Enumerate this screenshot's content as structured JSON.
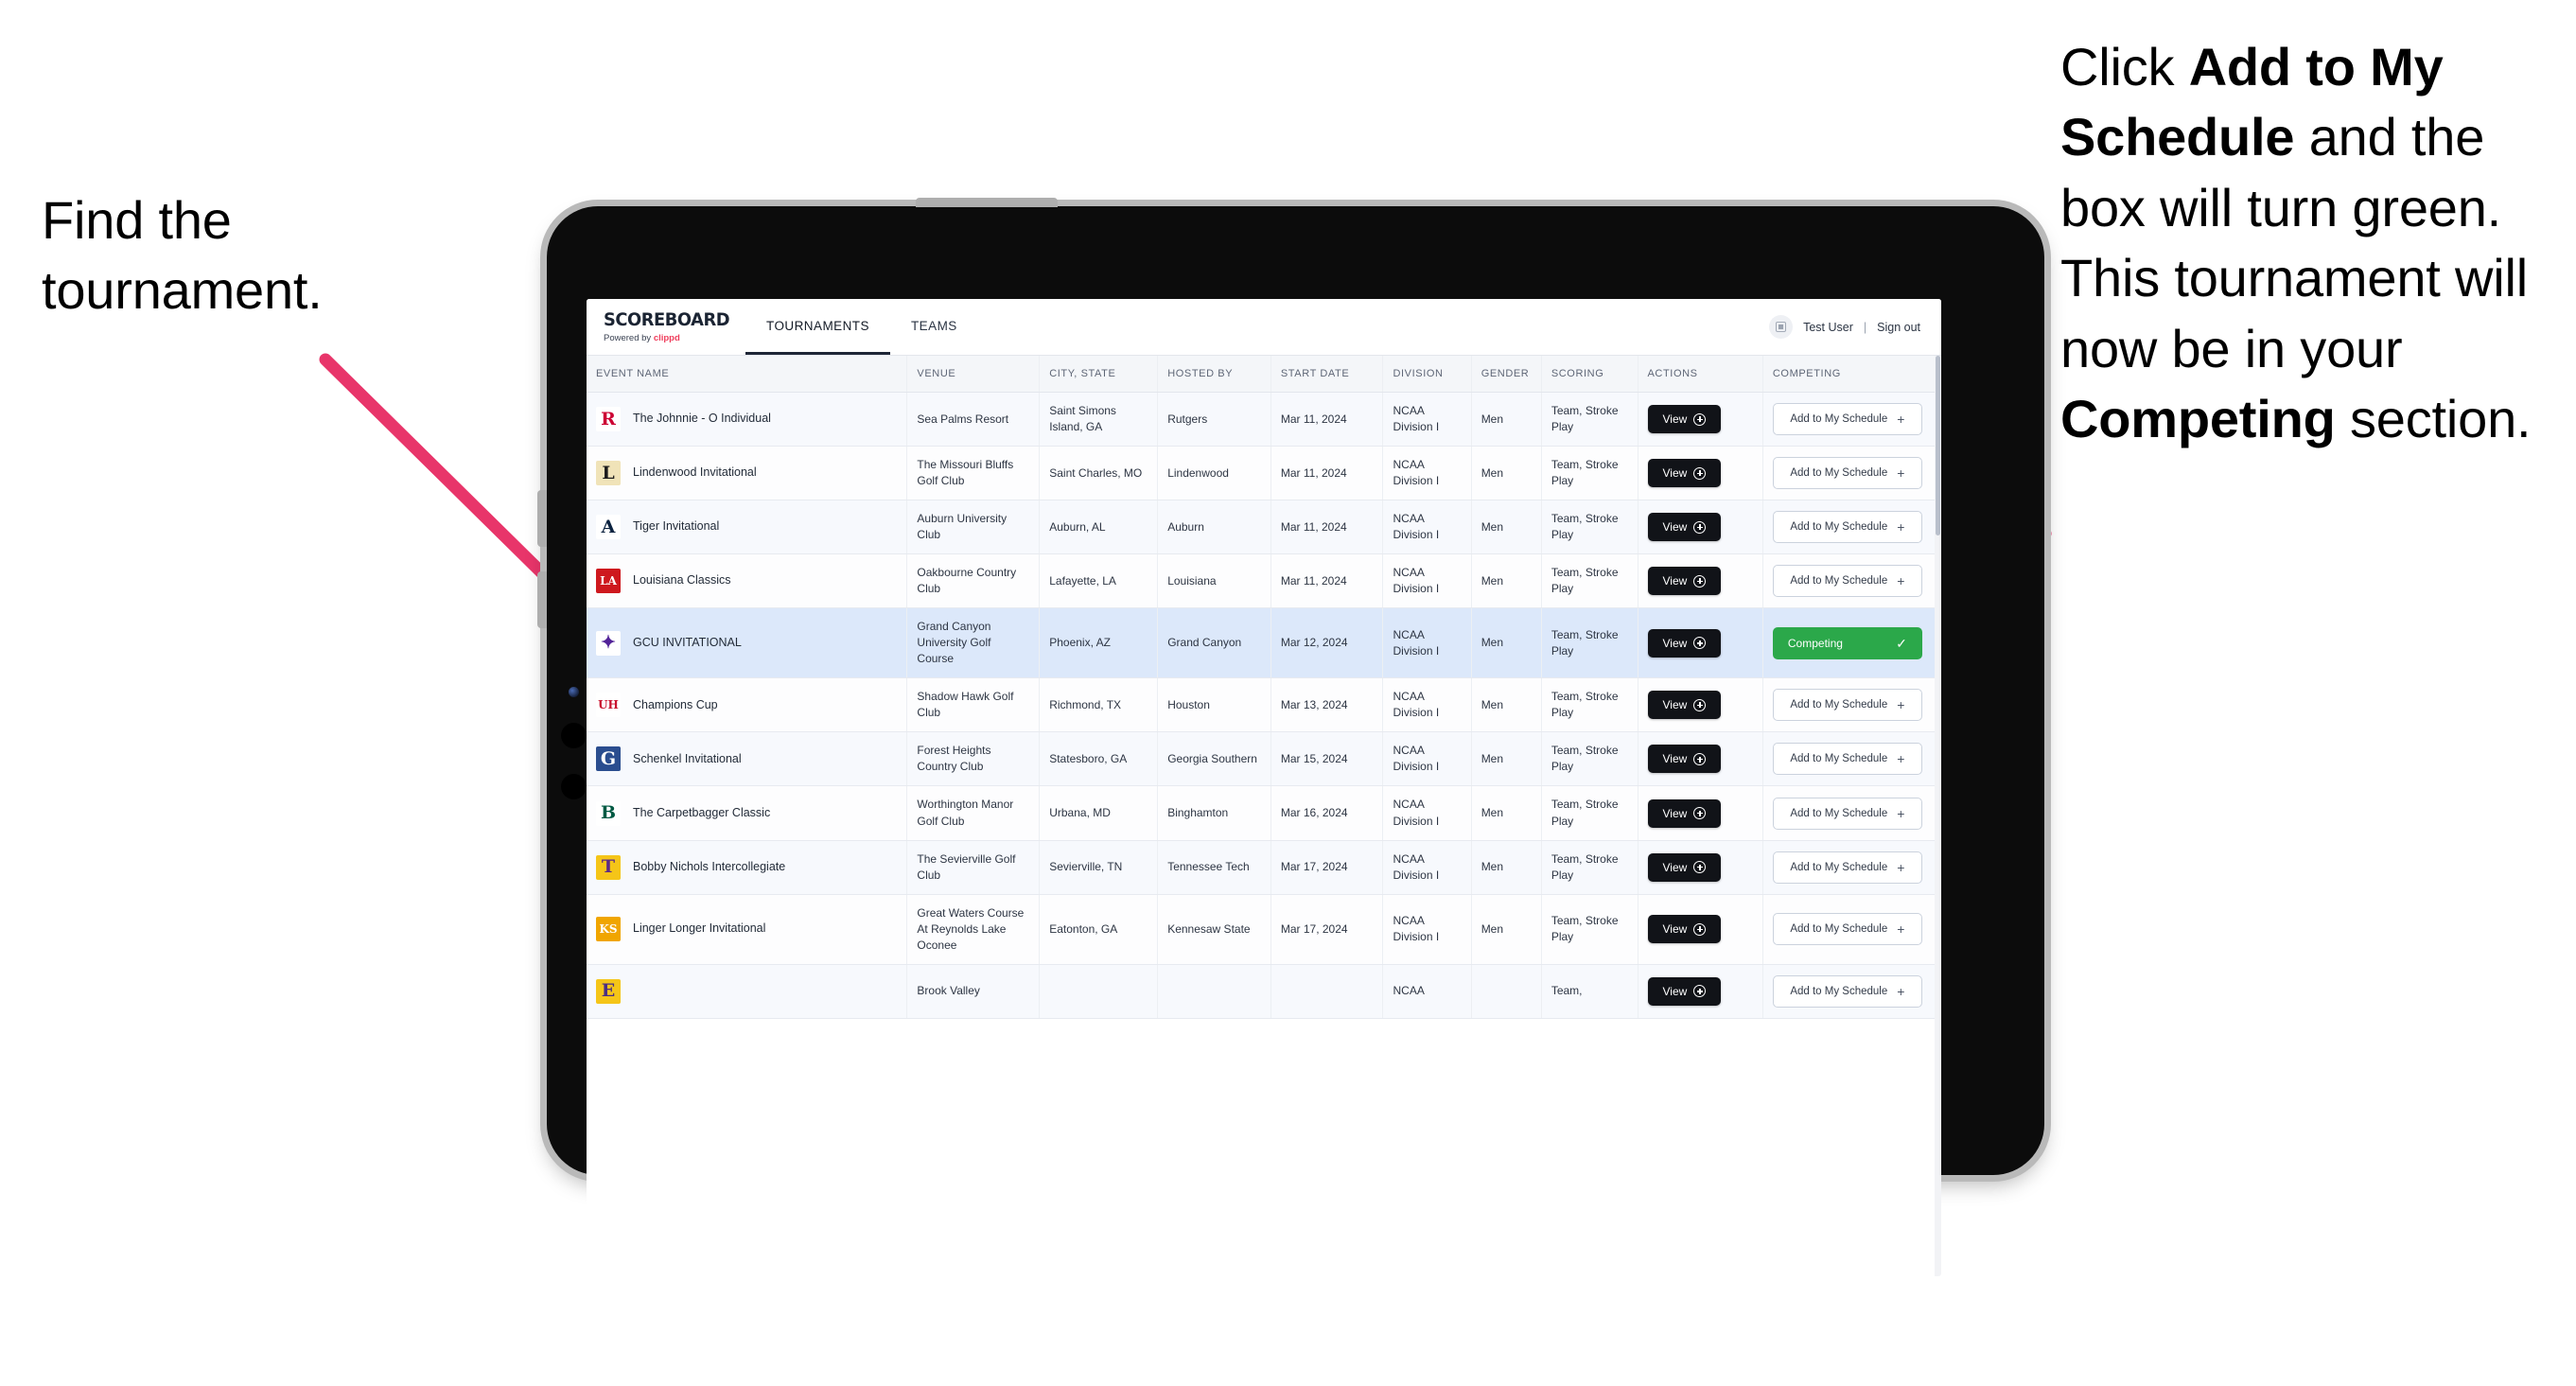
{
  "annotations": {
    "left": {
      "lines": [
        "Find the",
        "tournament."
      ]
    },
    "right": {
      "segments": [
        {
          "text": "Click ",
          "bold": false
        },
        {
          "text": "Add to My Schedule",
          "bold": true
        },
        {
          "text": " and the box will turn green. This tournament will now be in your ",
          "bold": false
        },
        {
          "text": "Competing",
          "bold": true
        },
        {
          "text": " section.",
          "bold": false
        }
      ]
    }
  },
  "arrow_color": "#e8356a",
  "accent_green": "#2ba84a",
  "app": {
    "brand": {
      "title": "SCOREBOARD",
      "powered_prefix": "Powered by ",
      "powered_name": "clippd"
    },
    "nav": [
      {
        "label": "TOURNAMENTS",
        "active": true
      },
      {
        "label": "TEAMS",
        "active": false
      }
    ],
    "account": {
      "avatar_icon": "user-grid-icon",
      "user_name": "Test User",
      "separator": "|",
      "sign_out": "Sign out"
    },
    "table": {
      "columns": [
        "EVENT NAME",
        "VENUE",
        "CITY, STATE",
        "HOSTED BY",
        "START DATE",
        "DIVISION",
        "GENDER",
        "SCORING",
        "ACTIONS",
        "COMPETING"
      ],
      "view_label": "View",
      "add_label": "Add to My Schedule",
      "add_plus": "+",
      "competing_label": "Competing",
      "competing_check": "✓",
      "rows": [
        {
          "logo": {
            "text": "R",
            "color": "#cc0033",
            "bg": "#ffffff"
          },
          "event": "The Johnnie - O Individual",
          "venue": "Sea Palms Resort",
          "city": "Saint Simons Island, GA",
          "host": "Rutgers",
          "date": "Mar 11, 2024",
          "division": "NCAA Division I",
          "gender": "Men",
          "scoring": "Team, Stroke Play",
          "competing": false
        },
        {
          "logo": {
            "text": "L",
            "color": "#1b1b1b",
            "bg": "#f0e3b8"
          },
          "event": "Lindenwood Invitational",
          "venue": "The Missouri Bluffs Golf Club",
          "city": "Saint Charles, MO",
          "host": "Lindenwood",
          "date": "Mar 11, 2024",
          "division": "NCAA Division I",
          "gender": "Men",
          "scoring": "Team, Stroke Play",
          "competing": false
        },
        {
          "logo": {
            "text": "A",
            "color": "#0c2340",
            "bg": "#ffffff"
          },
          "event": "Tiger Invitational",
          "venue": "Auburn University Club",
          "city": "Auburn, AL",
          "host": "Auburn",
          "date": "Mar 11, 2024",
          "division": "NCAA Division I",
          "gender": "Men",
          "scoring": "Team, Stroke Play",
          "competing": false
        },
        {
          "logo": {
            "text": "LA",
            "color": "#ffffff",
            "bg": "#ce181e"
          },
          "event": "Louisiana Classics",
          "venue": "Oakbourne Country Club",
          "city": "Lafayette, LA",
          "host": "Louisiana",
          "date": "Mar 11, 2024",
          "division": "NCAA Division I",
          "gender": "Men",
          "scoring": "Team, Stroke Play",
          "competing": false
        },
        {
          "logo": {
            "text": "✦",
            "color": "#522398",
            "bg": "#ffffff"
          },
          "event": "GCU INVITATIONAL",
          "venue": "Grand Canyon University Golf Course",
          "city": "Phoenix, AZ",
          "host": "Grand Canyon",
          "date": "Mar 12, 2024",
          "division": "NCAA Division I",
          "gender": "Men",
          "scoring": "Team, Stroke Play",
          "competing": true,
          "selected": true
        },
        {
          "logo": {
            "text": "UH",
            "color": "#c8102e",
            "bg": "#ffffff"
          },
          "event": "Champions Cup",
          "venue": "Shadow Hawk Golf Club",
          "city": "Richmond, TX",
          "host": "Houston",
          "date": "Mar 13, 2024",
          "division": "NCAA Division I",
          "gender": "Men",
          "scoring": "Team, Stroke Play",
          "competing": false
        },
        {
          "logo": {
            "text": "G",
            "color": "#ffffff",
            "bg": "#2a4d8f"
          },
          "event": "Schenkel Invitational",
          "venue": "Forest Heights Country Club",
          "city": "Statesboro, GA",
          "host": "Georgia Southern",
          "date": "Mar 15, 2024",
          "division": "NCAA Division I",
          "gender": "Men",
          "scoring": "Team, Stroke Play",
          "competing": false
        },
        {
          "logo": {
            "text": "B",
            "color": "#005a43",
            "bg": "#ffffff"
          },
          "event": "The Carpetbagger Classic",
          "venue": "Worthington Manor Golf Club",
          "city": "Urbana, MD",
          "host": "Binghamton",
          "date": "Mar 16, 2024",
          "division": "NCAA Division I",
          "gender": "Men",
          "scoring": "Team, Stroke Play",
          "competing": false
        },
        {
          "logo": {
            "text": "T",
            "color": "#5b2a86",
            "bg": "#f5c518"
          },
          "event": "Bobby Nichols Intercollegiate",
          "venue": "The Sevierville Golf Club",
          "city": "Sevierville, TN",
          "host": "Tennessee Tech",
          "date": "Mar 17, 2024",
          "division": "NCAA Division I",
          "gender": "Men",
          "scoring": "Team, Stroke Play",
          "competing": false
        },
        {
          "logo": {
            "text": "KS",
            "color": "#ffffff",
            "bg": "#f0a500"
          },
          "event": "Linger Longer Invitational",
          "venue": "Great Waters Course At Reynolds Lake Oconee",
          "city": "Eatonton, GA",
          "host": "Kennesaw State",
          "date": "Mar 17, 2024",
          "division": "NCAA Division I",
          "gender": "Men",
          "scoring": "Team, Stroke Play",
          "competing": false
        },
        {
          "logo": {
            "text": "E",
            "color": "#4b2e83",
            "bg": "#f5c518"
          },
          "event": "",
          "venue": "Brook Valley",
          "city": "",
          "host": "",
          "date": "",
          "division": "NCAA",
          "gender": "",
          "scoring": "Team,",
          "competing": false,
          "clipped": true
        }
      ]
    }
  }
}
